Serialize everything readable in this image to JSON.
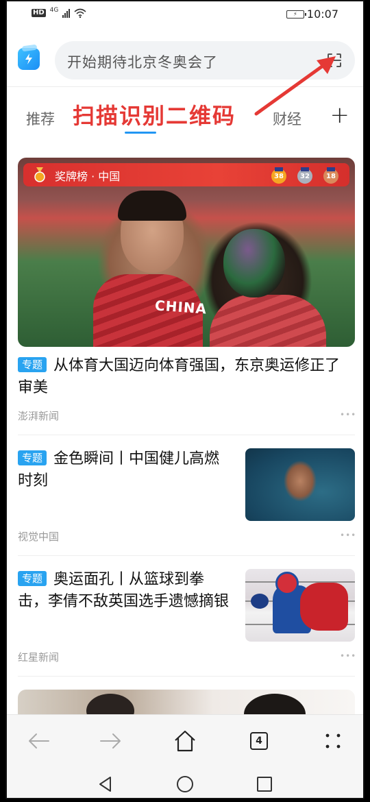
{
  "status_bar": {
    "left_badge": "HD",
    "network": "4G",
    "time": "10:07",
    "battery_icon": "battery-icon"
  },
  "search": {
    "query_text": "开始期待北京冬奥会了",
    "scan_icon": "scan-qr-icon"
  },
  "annotation": {
    "text": "扫描识别二维码",
    "color": "#e53935"
  },
  "tabs": {
    "items": [
      {
        "label": "推荐",
        "active": false
      },
      {
        "label": "财经",
        "active": false
      }
    ],
    "add_icon": "+"
  },
  "hero": {
    "banner_title": "奖牌榜 · 中国",
    "medals": [
      {
        "type": "gold",
        "count": "38",
        "color": "#f5a623"
      },
      {
        "type": "silver",
        "count": "32",
        "color": "#a9b1bd"
      },
      {
        "type": "bronze",
        "count": "18",
        "color": "#d98a5c"
      }
    ],
    "jersey_text": "CHINA"
  },
  "articles": [
    {
      "tag": "专题",
      "title": "从体育大国迈向体育强国，东京奥运修正了审美",
      "source": "澎湃新闻",
      "more": "•••"
    },
    {
      "tag": "专题",
      "title": "金色瞬间丨中国健儿高燃时刻",
      "source": "视觉中国",
      "more": "•••"
    },
    {
      "tag": "专题",
      "title": "奥运面孔丨从篮球到拳击，李倩不敌英国选手遗憾摘银",
      "source": "红星新闻",
      "more": "•••"
    }
  ],
  "toolbar": {
    "tab_count": "4"
  },
  "colors": {
    "accent": "#2196f3",
    "tag": "#29a3f0"
  }
}
